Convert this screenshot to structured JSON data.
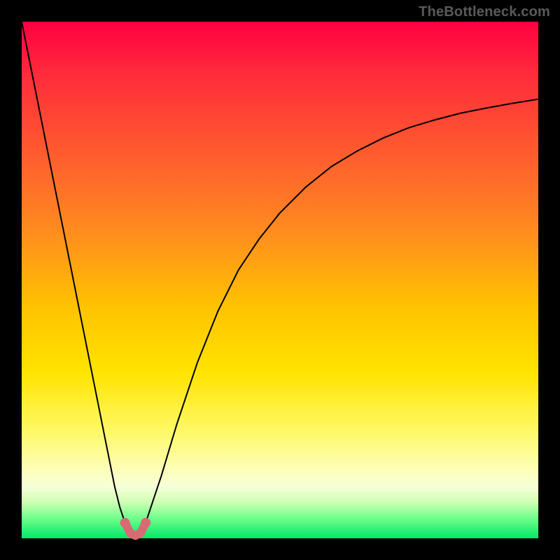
{
  "watermark": "TheBottleneck.com",
  "colors": {
    "frame_bg": "#000000",
    "curve_stroke": "#000000",
    "marker_stroke": "#d86a74",
    "watermark_text": "#5a5a5a",
    "gradient_stops": [
      "#ff0040",
      "#ff2b3a",
      "#ff5a2f",
      "#ff8a1f",
      "#ffc200",
      "#ffe400",
      "#fff75a",
      "#fdffb0",
      "#f6ffd8",
      "#cfffb4",
      "#74ff8c",
      "#00e86a"
    ]
  },
  "chart_data": {
    "type": "line",
    "title": "",
    "xlabel": "",
    "ylabel": "",
    "xlim": [
      0,
      100
    ],
    "ylim": [
      0,
      100
    ],
    "grid": false,
    "legend": false,
    "series": [
      {
        "name": "bottleneck-curve",
        "x": [
          0,
          2,
          4,
          6,
          8,
          10,
          12,
          14,
          16,
          18,
          19,
          20,
          21,
          22,
          23,
          24,
          25,
          27,
          30,
          34,
          38,
          42,
          46,
          50,
          55,
          60,
          65,
          70,
          75,
          80,
          85,
          90,
          95,
          100
        ],
        "y": [
          100,
          90,
          80,
          70,
          60,
          50,
          40,
          30,
          20,
          10,
          6,
          3,
          1,
          0.5,
          1,
          3,
          6,
          12,
          22,
          34,
          44,
          52,
          58,
          63,
          68,
          72,
          75,
          77.5,
          79.5,
          81,
          82.3,
          83.3,
          84.2,
          85
        ]
      }
    ],
    "highlight": {
      "name": "optimal-range",
      "x": [
        20,
        21,
        22,
        23,
        24
      ],
      "y": [
        3,
        1,
        0.5,
        1,
        3
      ]
    }
  }
}
